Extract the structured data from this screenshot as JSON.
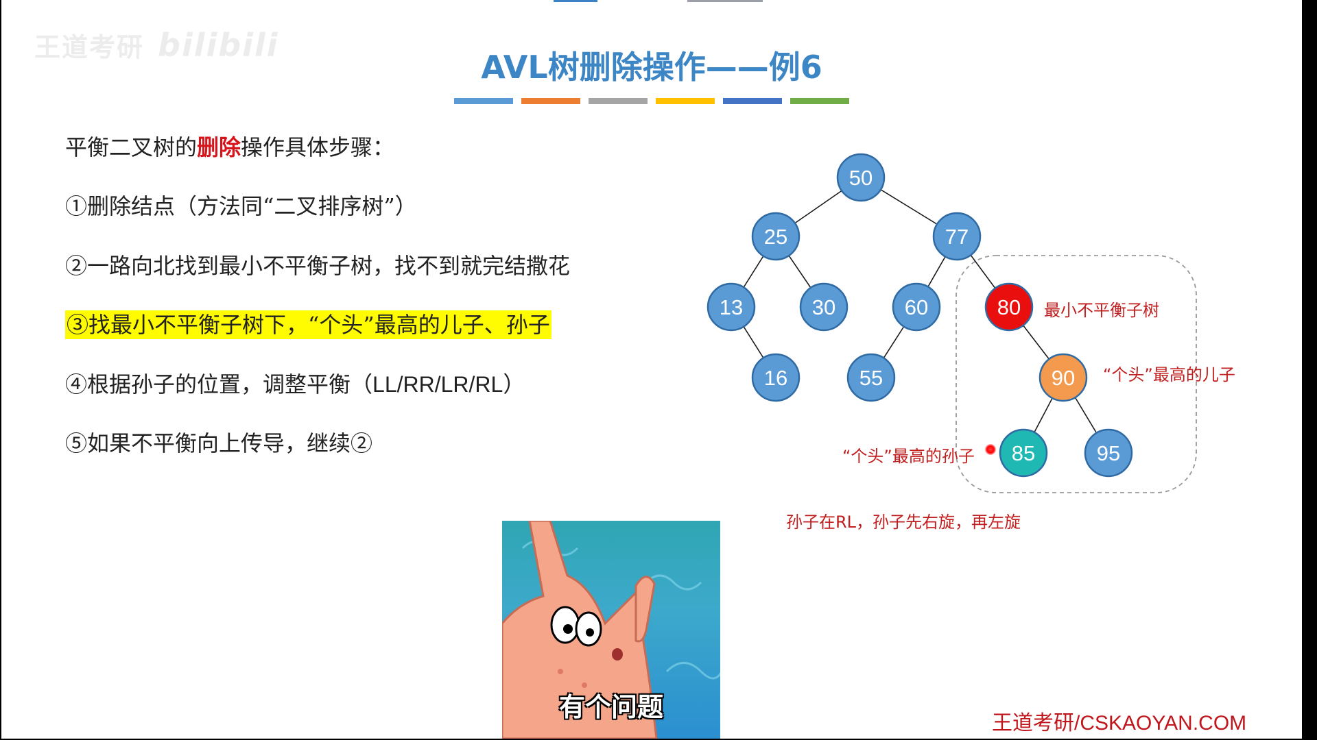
{
  "watermark": {
    "text": "王道考研",
    "brand": "bilibili"
  },
  "title": "AVL树删除操作——例6",
  "title_bar_colors": [
    "#5b9bd5",
    "#ed7d31",
    "#a5a5a5",
    "#ffc000",
    "#4472c4",
    "#70ad47"
  ],
  "steps": {
    "intro_before": "平衡二叉树的",
    "intro_emph": "删除",
    "intro_after": "操作具体步骤：",
    "s1": "①删除结点（方法同“二叉排序树”）",
    "s2": "②一路向北找到最小不平衡子树，找不到就完结撒花",
    "s3": "③找最小不平衡子树下，“个头”最高的儿子、孙子",
    "s4_a": "④根据孙子的位置，调整平衡（",
    "s4_b": "LL/RR/LR/RL",
    "s4_c": "）",
    "s5": "⑤如果不平衡向上传导，继续②"
  },
  "tree": {
    "nodes": [
      {
        "id": "n50",
        "label": "50",
        "role": "normal"
      },
      {
        "id": "n25",
        "label": "25",
        "role": "normal"
      },
      {
        "id": "n77",
        "label": "77",
        "role": "normal"
      },
      {
        "id": "n13",
        "label": "13",
        "role": "normal"
      },
      {
        "id": "n30",
        "label": "30",
        "role": "normal"
      },
      {
        "id": "n60",
        "label": "60",
        "role": "normal"
      },
      {
        "id": "n80",
        "label": "80",
        "role": "unbalanced"
      },
      {
        "id": "n16",
        "label": "16",
        "role": "normal"
      },
      {
        "id": "n55",
        "label": "55",
        "role": "normal"
      },
      {
        "id": "n90",
        "label": "90",
        "role": "tallest-child"
      },
      {
        "id": "n85",
        "label": "85",
        "role": "tallest-grandchild"
      },
      {
        "id": "n95",
        "label": "95",
        "role": "normal"
      }
    ],
    "edges": [
      [
        "n50",
        "n25"
      ],
      [
        "n50",
        "n77"
      ],
      [
        "n25",
        "n13"
      ],
      [
        "n25",
        "n30"
      ],
      [
        "n77",
        "n60"
      ],
      [
        "n77",
        "n80"
      ],
      [
        "n13",
        "n16"
      ],
      [
        "n60",
        "n55"
      ],
      [
        "n80",
        "n90"
      ],
      [
        "n90",
        "n85"
      ],
      [
        "n90",
        "n95"
      ]
    ],
    "colors": {
      "normal": "#5b9bd5",
      "unbalanced": "#ea0f0f",
      "tallest-child": "#f39a4e",
      "tallest-grandchild": "#1fb8b3"
    }
  },
  "annotations": {
    "unbalanced": "最小不平衡子树",
    "tallest_child": "“个头”最高的儿子",
    "tallest_grandchild": "“个头”最高的孙子",
    "rotation": "孙子在RL，孙子先右旋，再左旋"
  },
  "meme": {
    "caption": "有个问题"
  },
  "footer": "王道考研/CSKAOYAN.COM"
}
